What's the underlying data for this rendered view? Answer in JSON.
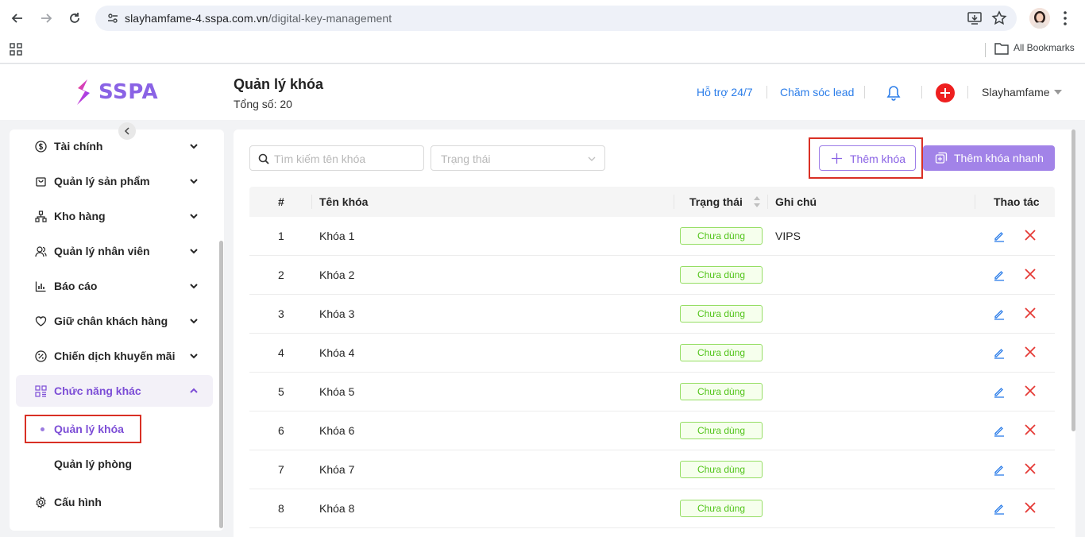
{
  "browser": {
    "url_domain": "slayhamfame-4.sspa.com.vn",
    "url_path": "/digital-key-management",
    "bookmarks_label": "All Bookmarks"
  },
  "header": {
    "logo_text": "SSPA",
    "title": "Quản lý khóa",
    "total": "Tổng số: 20",
    "support_link": "Hỗ trợ 24/7",
    "lead_link": "Chăm sóc lead",
    "user_name": "Slayhamfame"
  },
  "sidebar": {
    "items": [
      {
        "label": "Tài chính",
        "icon": "dollar-circle-icon"
      },
      {
        "label": "Quản lý sản phẩm",
        "icon": "shopping-bag-icon"
      },
      {
        "label": "Kho hàng",
        "icon": "cluster-icon"
      },
      {
        "label": "Quản lý nhân viên",
        "icon": "users-icon"
      },
      {
        "label": "Báo cáo",
        "icon": "bar-chart-icon"
      },
      {
        "label": "Giữ chân khách hàng",
        "icon": "heart-icon"
      },
      {
        "label": "Chiến dịch khuyến mãi",
        "icon": "percent-icon"
      },
      {
        "label": "Chức năng khác",
        "icon": "grid-icon"
      }
    ],
    "sub_items": [
      {
        "label": "Quản lý khóa",
        "active": true
      },
      {
        "label": "Quản lý phòng",
        "active": false
      }
    ],
    "config": {
      "label": "Cấu hình",
      "icon": "settings-icon"
    }
  },
  "toolbar": {
    "search_placeholder": "Tìm kiếm tên khóa",
    "status_placeholder": "Trạng thái",
    "add_label": "Thêm khóa",
    "quick_add_label": "Thêm khóa nhanh"
  },
  "table": {
    "columns": [
      "#",
      "Tên khóa",
      "Trạng thái",
      "Ghi chú",
      "Thao tác"
    ],
    "rows": [
      {
        "no": "1",
        "name": "Khóa 1",
        "status": "Chưa dùng",
        "note": "VIPS"
      },
      {
        "no": "2",
        "name": "Khóa 2",
        "status": "Chưa dùng",
        "note": ""
      },
      {
        "no": "3",
        "name": "Khóa 3",
        "status": "Chưa dùng",
        "note": ""
      },
      {
        "no": "4",
        "name": "Khóa 4",
        "status": "Chưa dùng",
        "note": ""
      },
      {
        "no": "5",
        "name": "Khóa 5",
        "status": "Chưa dùng",
        "note": ""
      },
      {
        "no": "6",
        "name": "Khóa 6",
        "status": "Chưa dùng",
        "note": ""
      },
      {
        "no": "7",
        "name": "Khóa 7",
        "status": "Chưa dùng",
        "note": ""
      },
      {
        "no": "8",
        "name": "Khóa 8",
        "status": "Chưa dùng",
        "note": ""
      }
    ]
  },
  "colors": {
    "brand": "#8a63e5",
    "link": "#2b7de9",
    "status_green": "#52c41a",
    "delete_red": "#e53935",
    "highlight": "#d93025"
  }
}
